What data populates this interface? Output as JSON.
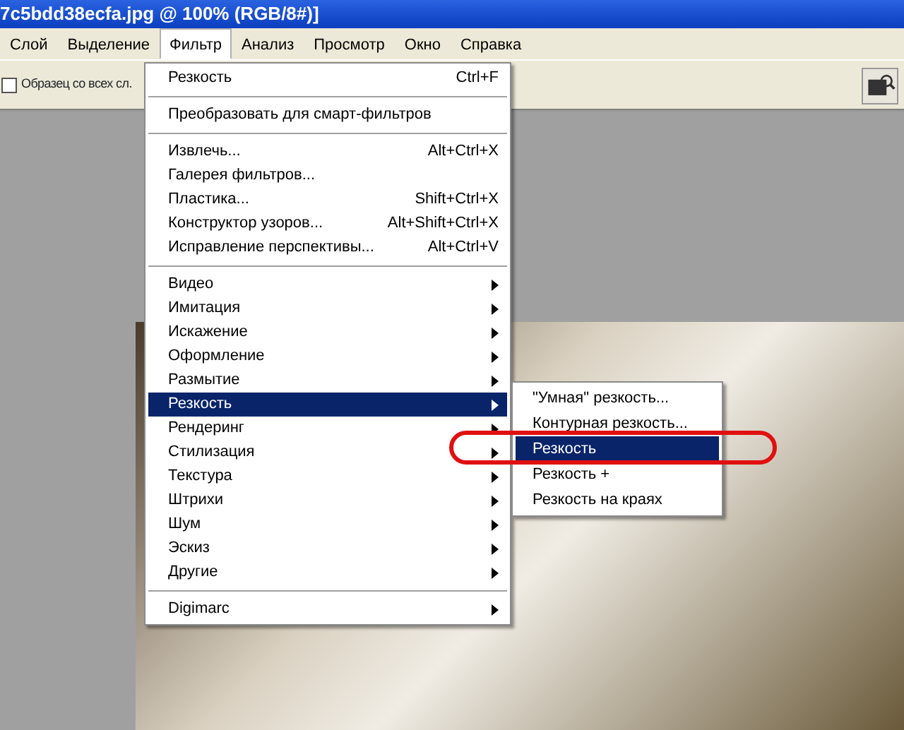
{
  "window": {
    "title": "7c5bdd38ecfa.jpg @ 100% (RGB/8#)]"
  },
  "menubar": [
    {
      "label": "Слой",
      "selected": false
    },
    {
      "label": "Выделение",
      "selected": false
    },
    {
      "label": "Фильтр",
      "selected": true
    },
    {
      "label": "Анализ",
      "selected": false
    },
    {
      "label": "Просмотр",
      "selected": false
    },
    {
      "label": "Окно",
      "selected": false
    },
    {
      "label": "Справка",
      "selected": false
    }
  ],
  "options_bar": {
    "checkbox": {
      "label": "Образец со всех сл.",
      "checked": false
    }
  },
  "filter_menu": {
    "sections": [
      [
        {
          "label": "Резкость",
          "shortcut": "Ctrl+F",
          "submenu": false,
          "selected": false
        }
      ],
      [
        {
          "label": "Преобразовать для смарт-фильтров",
          "submenu": false,
          "selected": false
        }
      ],
      [
        {
          "label": "Извлечь...",
          "shortcut": "Alt+Ctrl+X",
          "submenu": false,
          "selected": false
        },
        {
          "label": "Галерея фильтров...",
          "submenu": false,
          "selected": false
        },
        {
          "label": "Пластика...",
          "shortcut": "Shift+Ctrl+X",
          "submenu": false,
          "selected": false
        },
        {
          "label": "Конструктор узоров...",
          "shortcut": "Alt+Shift+Ctrl+X",
          "submenu": false,
          "selected": false
        },
        {
          "label": "Исправление перспективы...",
          "shortcut": "Alt+Ctrl+V",
          "submenu": false,
          "selected": false
        }
      ],
      [
        {
          "label": "Видео",
          "submenu": true,
          "selected": false
        },
        {
          "label": "Имитация",
          "submenu": true,
          "selected": false
        },
        {
          "label": "Искажение",
          "submenu": true,
          "selected": false
        },
        {
          "label": "Оформление",
          "submenu": true,
          "selected": false
        },
        {
          "label": "Размытие",
          "submenu": true,
          "selected": false
        },
        {
          "label": "Резкость",
          "submenu": true,
          "selected": true
        },
        {
          "label": "Рендеринг",
          "submenu": true,
          "selected": false
        },
        {
          "label": "Стилизация",
          "submenu": true,
          "selected": false
        },
        {
          "label": "Текстура",
          "submenu": true,
          "selected": false
        },
        {
          "label": "Штрихи",
          "submenu": true,
          "selected": false
        },
        {
          "label": "Шум",
          "submenu": true,
          "selected": false
        },
        {
          "label": "Эскиз",
          "submenu": true,
          "selected": false
        },
        {
          "label": "Другие",
          "submenu": true,
          "selected": false
        }
      ],
      [
        {
          "label": "Digimarc",
          "submenu": true,
          "selected": false
        }
      ]
    ]
  },
  "submenu": [
    {
      "label": "\"Умная\" резкость...",
      "selected": false
    },
    {
      "label": "Контурная резкость...",
      "selected": false
    },
    {
      "label": "Резкость",
      "selected": true
    },
    {
      "label": "Резкость +",
      "selected": false
    },
    {
      "label": "Резкость на краях",
      "selected": false
    }
  ]
}
